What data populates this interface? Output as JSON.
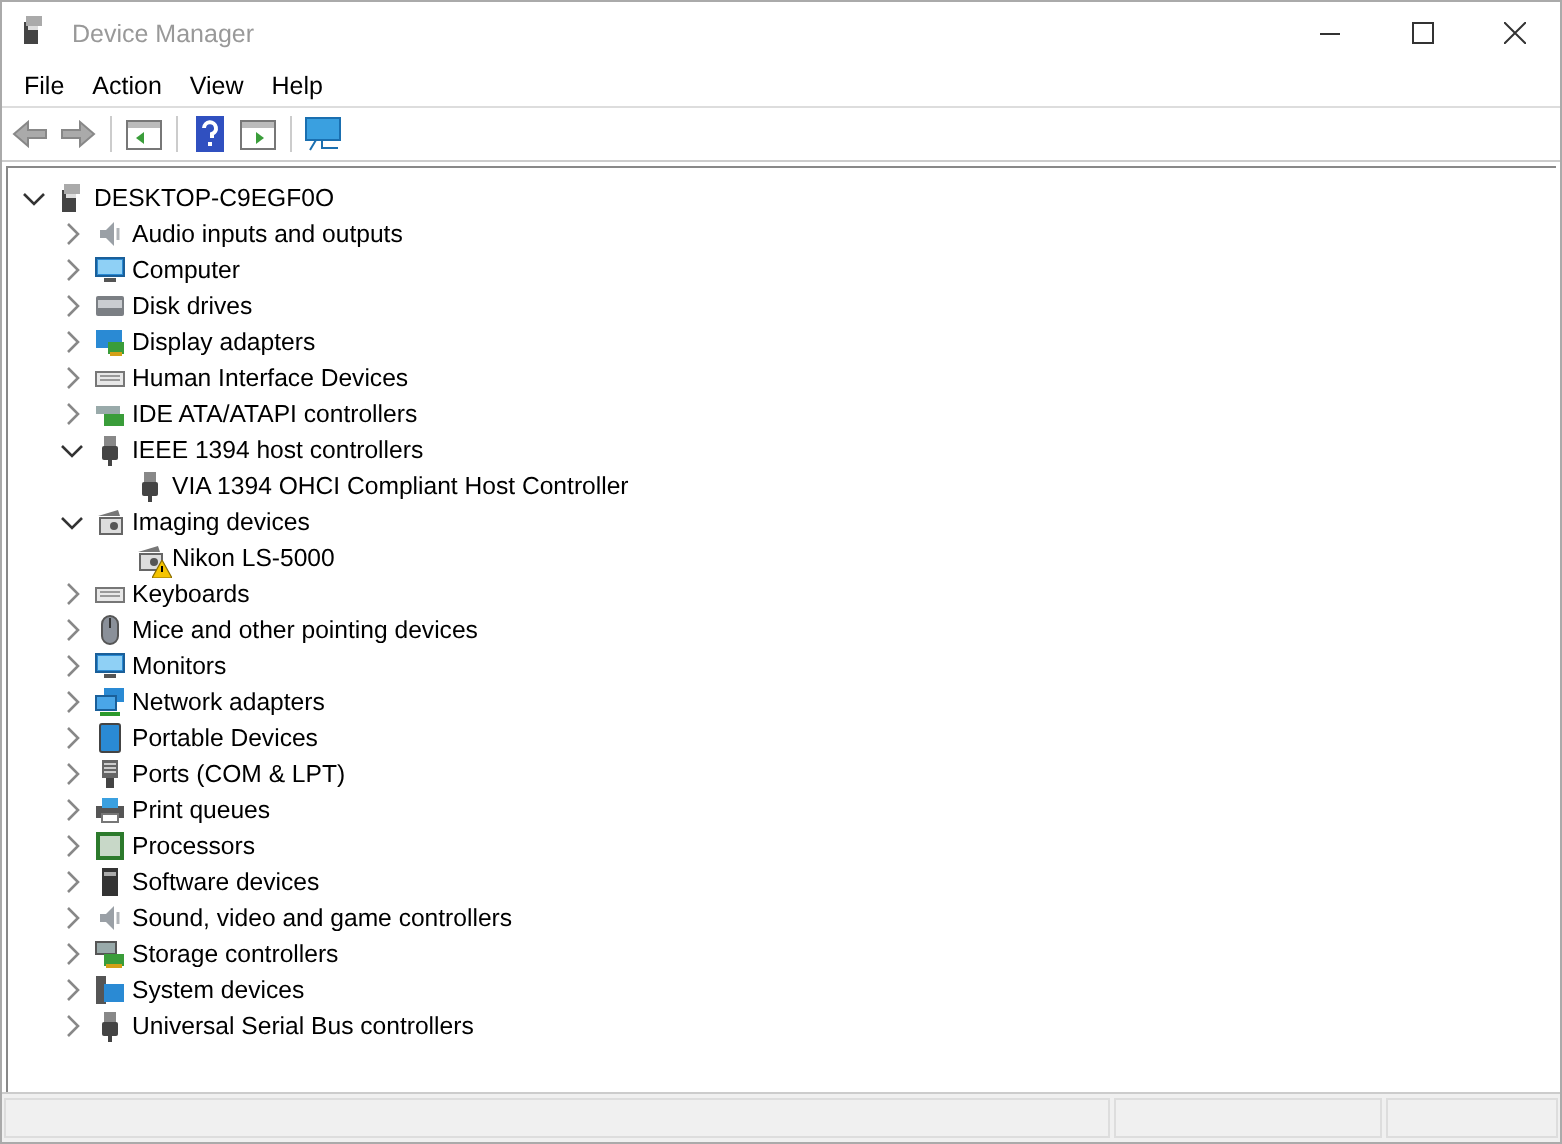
{
  "window": {
    "title": "Device Manager"
  },
  "menu": [
    "File",
    "Action",
    "View",
    "Help"
  ],
  "tree": {
    "label": "DESKTOP-C9EGF0O",
    "expanded": true,
    "children": [
      {
        "label": "Audio inputs and outputs",
        "expanded": false
      },
      {
        "label": "Computer",
        "expanded": false
      },
      {
        "label": "Disk drives",
        "expanded": false
      },
      {
        "label": "Display adapters",
        "expanded": false
      },
      {
        "label": "Human Interface Devices",
        "expanded": false
      },
      {
        "label": "IDE ATA/ATAPI controllers",
        "expanded": false
      },
      {
        "label": "IEEE 1394 host controllers",
        "expanded": true,
        "children": [
          {
            "label": "VIA 1394 OHCI Compliant Host Controller",
            "warning": false
          }
        ]
      },
      {
        "label": "Imaging devices",
        "expanded": true,
        "children": [
          {
            "label": "Nikon LS-5000",
            "warning": true
          }
        ]
      },
      {
        "label": "Keyboards",
        "expanded": false
      },
      {
        "label": "Mice and other pointing devices",
        "expanded": false
      },
      {
        "label": "Monitors",
        "expanded": false
      },
      {
        "label": "Network adapters",
        "expanded": false
      },
      {
        "label": "Portable Devices",
        "expanded": false
      },
      {
        "label": "Ports (COM & LPT)",
        "expanded": false
      },
      {
        "label": "Print queues",
        "expanded": false
      },
      {
        "label": "Processors",
        "expanded": false
      },
      {
        "label": "Software devices",
        "expanded": false
      },
      {
        "label": "Sound, video and game controllers",
        "expanded": false
      },
      {
        "label": "Storage controllers",
        "expanded": false
      },
      {
        "label": "System devices",
        "expanded": false
      },
      {
        "label": "Universal Serial Bus controllers",
        "expanded": false
      }
    ]
  }
}
